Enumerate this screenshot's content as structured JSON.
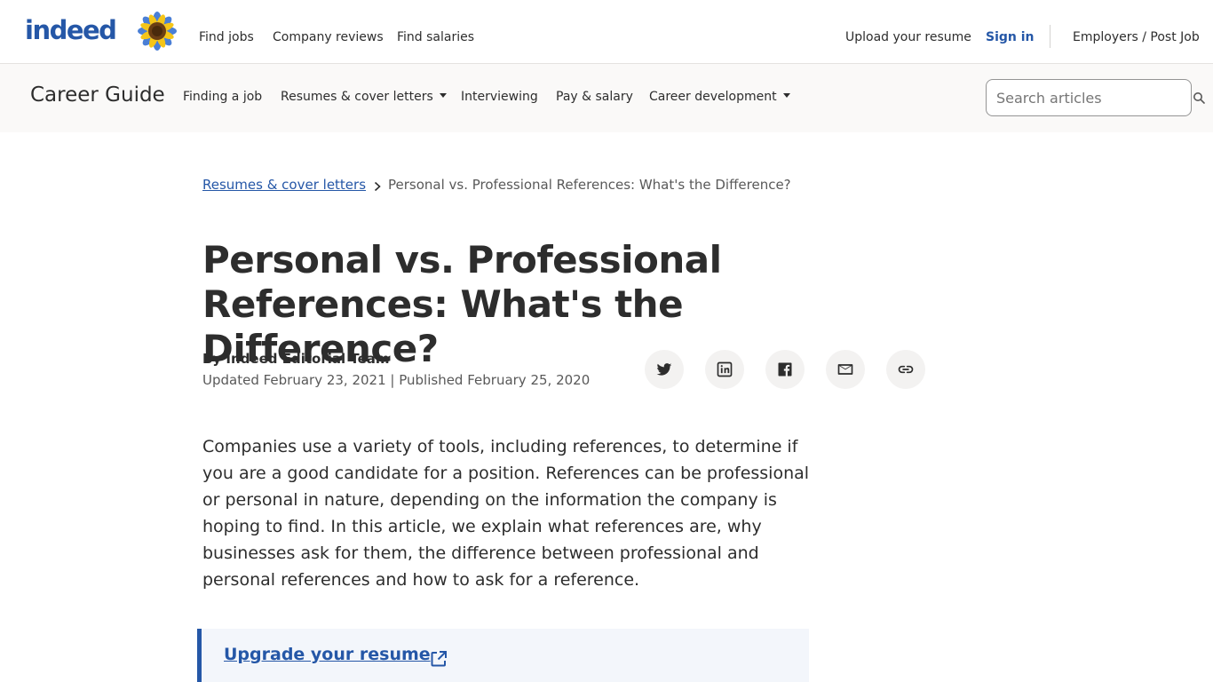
{
  "header": {
    "logo_text": "indeed",
    "nav": {
      "find_jobs": "Find jobs",
      "company_reviews": "Company reviews",
      "find_salaries": "Find salaries"
    },
    "upload_resume": "Upload your resume",
    "sign_in": "Sign in",
    "employers": "Employers / Post Job"
  },
  "guidebar": {
    "title": "Career Guide",
    "links": {
      "finding_job": "Finding a job",
      "resumes": "Resumes & cover letters",
      "interviewing": "Interviewing",
      "pay": "Pay & salary",
      "career_dev": "Career development"
    },
    "search_placeholder": "Search articles"
  },
  "breadcrumb": {
    "parent": "Resumes & cover letters",
    "current": "Personal vs. Professional References: What's the Difference?"
  },
  "article": {
    "title": "Personal vs. Professional References: What's the Difference?",
    "byline": "By Indeed Editorial Team",
    "dates": "Updated February 23, 2021 | Published February 25, 2020",
    "intro": "Companies use a variety of tools, including references, to determine if you are a good candidate for a position. References can be professional or personal in nature, depending on the information the company is hoping to find. In this article, we explain what references are, why businesses ask for them, the difference between professional and personal references and how to ask for a reference.",
    "callout_link": "Upgrade your resume"
  },
  "share_icons": [
    "twitter-icon",
    "linkedin-icon",
    "facebook-icon",
    "email-icon",
    "link-icon"
  ],
  "colors": {
    "brand_blue": "#2557a7",
    "text": "#2d2d2d",
    "muted": "#595959",
    "guidebar_bg": "#faf9f8",
    "share_bg": "#f3f2f1",
    "callout_bg": "#f3f6fb"
  }
}
